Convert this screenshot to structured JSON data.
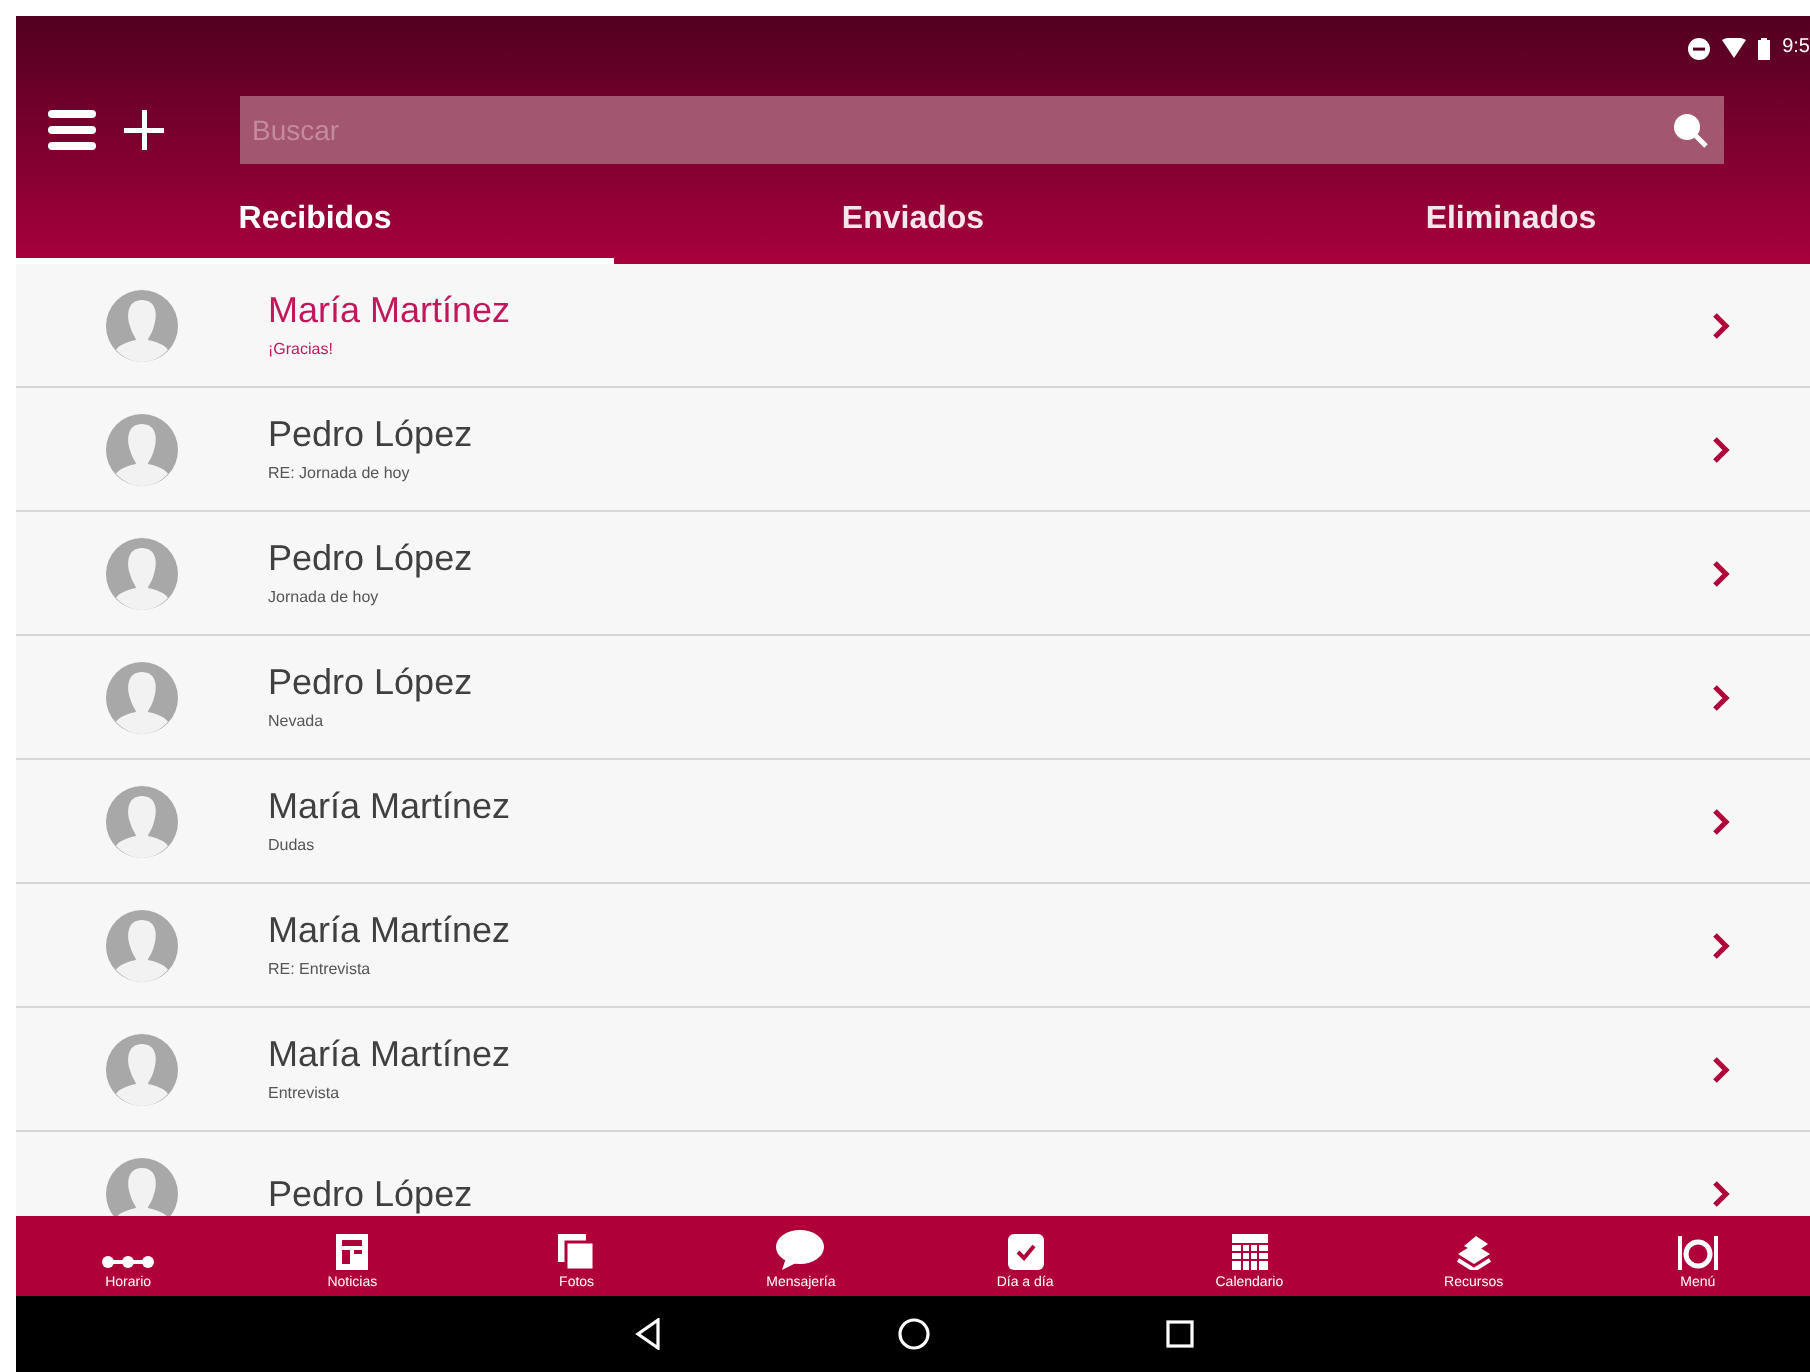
{
  "status_bar": {
    "time": "9:5"
  },
  "toolbar": {
    "search": {
      "placeholder": "Buscar"
    }
  },
  "tabs": [
    {
      "label": "Recibidos",
      "selected": true
    },
    {
      "label": "Enviados",
      "selected": false
    },
    {
      "label": "Eliminados",
      "selected": false
    }
  ],
  "messages": [
    {
      "sender": "María Martínez",
      "subject": "¡Gracias!",
      "unread": true
    },
    {
      "sender": "Pedro López",
      "subject": "RE: Jornada de hoy",
      "unread": false
    },
    {
      "sender": "Pedro López",
      "subject": "Jornada de hoy",
      "unread": false
    },
    {
      "sender": "Pedro López",
      "subject": "Nevada",
      "unread": false
    },
    {
      "sender": "María Martínez",
      "subject": "Dudas",
      "unread": false
    },
    {
      "sender": "María Martínez",
      "subject": "RE: Entrevista",
      "unread": false
    },
    {
      "sender": "María Martínez",
      "subject": "Entrevista",
      "unread": false
    },
    {
      "sender": "Pedro López",
      "unread": false
    }
  ],
  "bottom_nav": [
    {
      "kind": "horario",
      "label": "Horario"
    },
    {
      "kind": "noticias",
      "label": "Noticias"
    },
    {
      "kind": "fotos",
      "label": "Fotos"
    },
    {
      "kind": "mensajeria",
      "label": "Mensajería"
    },
    {
      "kind": "dia",
      "label": "Día a día"
    },
    {
      "kind": "calendario",
      "label": "Calendario"
    },
    {
      "kind": "recursos",
      "label": "Recursos"
    },
    {
      "kind": "menu",
      "label": "Menú"
    }
  ]
}
